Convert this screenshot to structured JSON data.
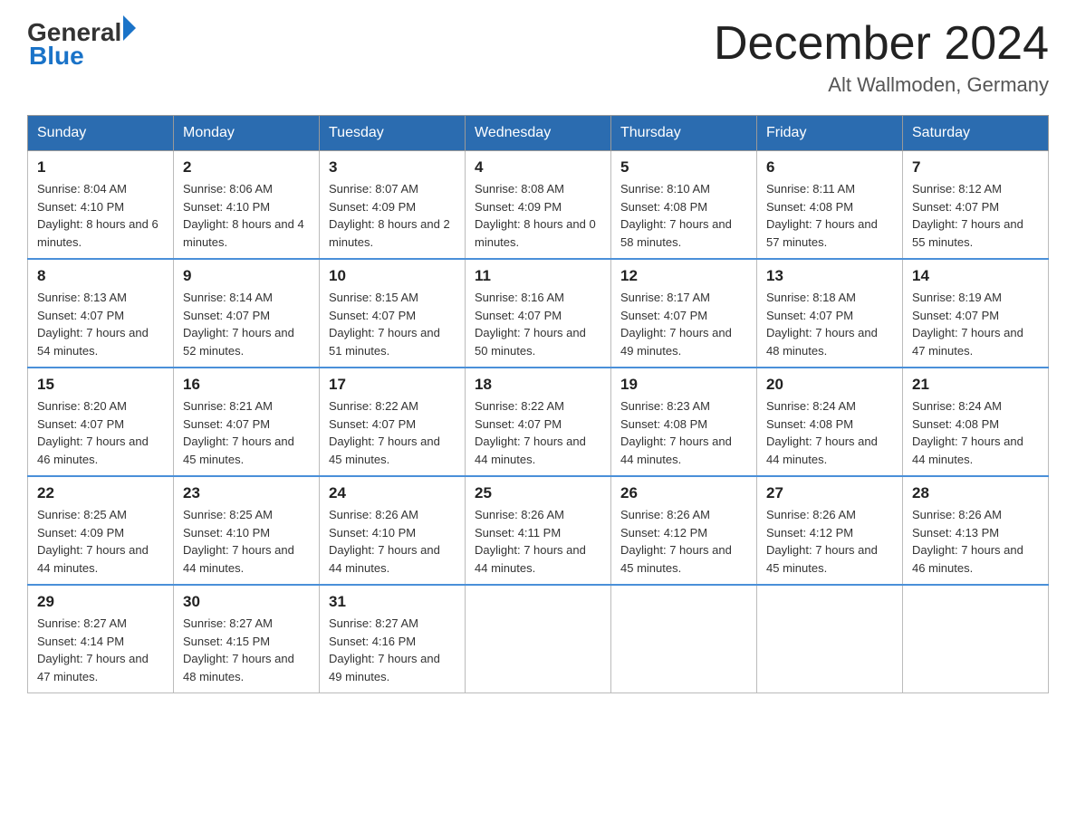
{
  "header": {
    "logo_general": "General",
    "logo_blue": "Blue",
    "month_title": "December 2024",
    "location": "Alt Wallmoden, Germany"
  },
  "calendar": {
    "days_of_week": [
      "Sunday",
      "Monday",
      "Tuesday",
      "Wednesday",
      "Thursday",
      "Friday",
      "Saturday"
    ],
    "weeks": [
      [
        {
          "day": "1",
          "sunrise": "8:04 AM",
          "sunset": "4:10 PM",
          "daylight": "8 hours and 6 minutes."
        },
        {
          "day": "2",
          "sunrise": "8:06 AM",
          "sunset": "4:10 PM",
          "daylight": "8 hours and 4 minutes."
        },
        {
          "day": "3",
          "sunrise": "8:07 AM",
          "sunset": "4:09 PM",
          "daylight": "8 hours and 2 minutes."
        },
        {
          "day": "4",
          "sunrise": "8:08 AM",
          "sunset": "4:09 PM",
          "daylight": "8 hours and 0 minutes."
        },
        {
          "day": "5",
          "sunrise": "8:10 AM",
          "sunset": "4:08 PM",
          "daylight": "7 hours and 58 minutes."
        },
        {
          "day": "6",
          "sunrise": "8:11 AM",
          "sunset": "4:08 PM",
          "daylight": "7 hours and 57 minutes."
        },
        {
          "day": "7",
          "sunrise": "8:12 AM",
          "sunset": "4:07 PM",
          "daylight": "7 hours and 55 minutes."
        }
      ],
      [
        {
          "day": "8",
          "sunrise": "8:13 AM",
          "sunset": "4:07 PM",
          "daylight": "7 hours and 54 minutes."
        },
        {
          "day": "9",
          "sunrise": "8:14 AM",
          "sunset": "4:07 PM",
          "daylight": "7 hours and 52 minutes."
        },
        {
          "day": "10",
          "sunrise": "8:15 AM",
          "sunset": "4:07 PM",
          "daylight": "7 hours and 51 minutes."
        },
        {
          "day": "11",
          "sunrise": "8:16 AM",
          "sunset": "4:07 PM",
          "daylight": "7 hours and 50 minutes."
        },
        {
          "day": "12",
          "sunrise": "8:17 AM",
          "sunset": "4:07 PM",
          "daylight": "7 hours and 49 minutes."
        },
        {
          "day": "13",
          "sunrise": "8:18 AM",
          "sunset": "4:07 PM",
          "daylight": "7 hours and 48 minutes."
        },
        {
          "day": "14",
          "sunrise": "8:19 AM",
          "sunset": "4:07 PM",
          "daylight": "7 hours and 47 minutes."
        }
      ],
      [
        {
          "day": "15",
          "sunrise": "8:20 AM",
          "sunset": "4:07 PM",
          "daylight": "7 hours and 46 minutes."
        },
        {
          "day": "16",
          "sunrise": "8:21 AM",
          "sunset": "4:07 PM",
          "daylight": "7 hours and 45 minutes."
        },
        {
          "day": "17",
          "sunrise": "8:22 AM",
          "sunset": "4:07 PM",
          "daylight": "7 hours and 45 minutes."
        },
        {
          "day": "18",
          "sunrise": "8:22 AM",
          "sunset": "4:07 PM",
          "daylight": "7 hours and 44 minutes."
        },
        {
          "day": "19",
          "sunrise": "8:23 AM",
          "sunset": "4:08 PM",
          "daylight": "7 hours and 44 minutes."
        },
        {
          "day": "20",
          "sunrise": "8:24 AM",
          "sunset": "4:08 PM",
          "daylight": "7 hours and 44 minutes."
        },
        {
          "day": "21",
          "sunrise": "8:24 AM",
          "sunset": "4:08 PM",
          "daylight": "7 hours and 44 minutes."
        }
      ],
      [
        {
          "day": "22",
          "sunrise": "8:25 AM",
          "sunset": "4:09 PM",
          "daylight": "7 hours and 44 minutes."
        },
        {
          "day": "23",
          "sunrise": "8:25 AM",
          "sunset": "4:10 PM",
          "daylight": "7 hours and 44 minutes."
        },
        {
          "day": "24",
          "sunrise": "8:26 AM",
          "sunset": "4:10 PM",
          "daylight": "7 hours and 44 minutes."
        },
        {
          "day": "25",
          "sunrise": "8:26 AM",
          "sunset": "4:11 PM",
          "daylight": "7 hours and 44 minutes."
        },
        {
          "day": "26",
          "sunrise": "8:26 AM",
          "sunset": "4:12 PM",
          "daylight": "7 hours and 45 minutes."
        },
        {
          "day": "27",
          "sunrise": "8:26 AM",
          "sunset": "4:12 PM",
          "daylight": "7 hours and 45 minutes."
        },
        {
          "day": "28",
          "sunrise": "8:26 AM",
          "sunset": "4:13 PM",
          "daylight": "7 hours and 46 minutes."
        }
      ],
      [
        {
          "day": "29",
          "sunrise": "8:27 AM",
          "sunset": "4:14 PM",
          "daylight": "7 hours and 47 minutes."
        },
        {
          "day": "30",
          "sunrise": "8:27 AM",
          "sunset": "4:15 PM",
          "daylight": "7 hours and 48 minutes."
        },
        {
          "day": "31",
          "sunrise": "8:27 AM",
          "sunset": "4:16 PM",
          "daylight": "7 hours and 49 minutes."
        },
        null,
        null,
        null,
        null
      ]
    ]
  }
}
